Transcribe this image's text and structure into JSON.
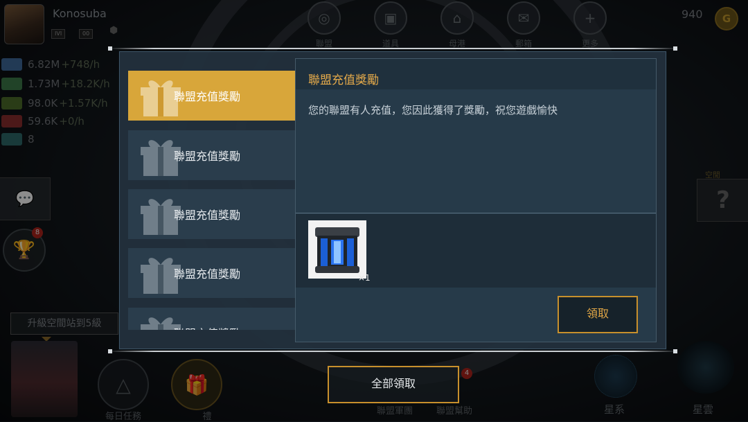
{
  "player": {
    "name": "Konosuba",
    "badges": [
      "IVI",
      "00"
    ]
  },
  "resources": [
    {
      "value": "6.82M",
      "rate": "+748/h",
      "color": "#3f6b9b"
    },
    {
      "value": "1.73M",
      "rate": "+18.2K/h",
      "color": "#3c7a4a"
    },
    {
      "value": "98.0K",
      "rate": "+1.57K/h",
      "color": "#4d6d2a"
    },
    {
      "value": "59.6K",
      "rate": "+0/h",
      "color": "#8a2f2f"
    },
    {
      "value": "8",
      "rate": "",
      "color": "#2f6b6b"
    }
  ],
  "top_nav": [
    "聯盟",
    "道具",
    "母港",
    "郵箱",
    "更多"
  ],
  "currency": {
    "amount": "940",
    "icon": "G"
  },
  "side": {
    "trophy_badge": "8",
    "upgrade_label": "升級空間站到5級",
    "right_label": "空閒"
  },
  "bottom_nav": {
    "daily": "每日任務",
    "gift_hint": "禮",
    "alliance_corps": "聯盟軍團",
    "alliance_help": "聯盟幫助",
    "alliance_help_badge": "4",
    "galaxy": "星系",
    "nebula": "星雲"
  },
  "reward_list": [
    {
      "label": "聯盟充值獎勵",
      "active": true
    },
    {
      "label": "聯盟充值獎勵",
      "active": false
    },
    {
      "label": "聯盟充值獎勵",
      "active": false
    },
    {
      "label": "聯盟充值獎勵",
      "active": false
    },
    {
      "label": "聯盟充值獎勵",
      "active": false
    }
  ],
  "detail": {
    "title": "聯盟充值獎勵",
    "message": "您的聯盟有人充值，您因此獲得了獎勵，祝您遊戲愉快",
    "reward_qty": "×1",
    "claim_label": "領取"
  },
  "claim_all_label": "全部領取",
  "colors": {
    "accent": "#d8a63a",
    "button_border": "#c8902c",
    "title": "#e3a94a"
  }
}
